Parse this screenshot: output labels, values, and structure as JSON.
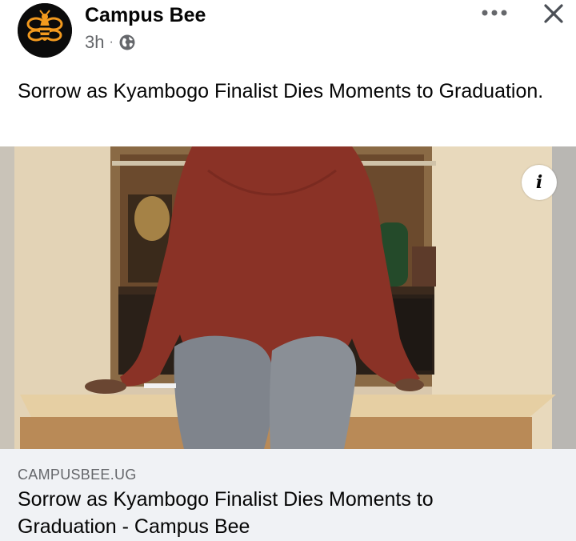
{
  "post": {
    "page_name": "Campus Bee",
    "time_ago": "3h",
    "separator": "·",
    "privacy_icon": "globe-icon",
    "text": "Sorrow as Kyambogo Finalist Dies Moments to Graduation.",
    "more_icon": "more-options-icon",
    "close_icon": "close-icon"
  },
  "link_preview": {
    "domain": "CAMPUSBEE.UG",
    "title": "Sorrow as Kyambogo Finalist Dies Moments to Graduation - Campus Bee",
    "info_label": "i"
  },
  "colors": {
    "avatar_bg": "#0b0b0b",
    "bee_orange": "#f39a1e",
    "card_bg": "#f0f2f5",
    "secondary_text": "#65676b"
  }
}
